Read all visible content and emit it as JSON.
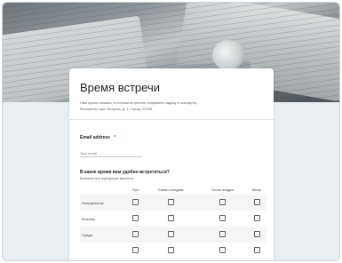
{
  "form": {
    "title": "Время встречи",
    "description": "Нам нужно позвать, в полном встретить поправить задачу в основу/пр...",
    "details": "Выполнить при: Встреча, д. 1, Город, 12345",
    "email": {
      "label": "Email address",
      "required_mark": "*",
      "placeholder": "Your email"
    },
    "time_question": {
      "label": "В какое время вам удобно встретиться?",
      "hint": "Выберите все подходящие варианты",
      "columns": [
        "Утро",
        "Ближе к полудню",
        "После полудня",
        "Вечер"
      ],
      "rows": [
        "Понедельник",
        "Вторник",
        "Среда",
        ""
      ]
    }
  }
}
